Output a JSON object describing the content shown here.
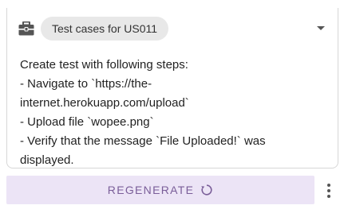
{
  "card": {
    "chip_label": "Test cases for US011",
    "icons": {
      "leading": "briefcase-icon",
      "dropdown": "chevron-down-icon"
    },
    "lines": [
      "Create test with following steps:",
      "- Navigate to `https://the-",
      "internet.herokuapp.com/upload`",
      "- Upload file `wopee.png`",
      "- Verify that the message `File Uploaded!` was",
      "displayed."
    ]
  },
  "actions": {
    "regenerate_label": "REGENERATE",
    "regenerate_icon": "refresh-icon",
    "more_icon": "more-vert-icon"
  },
  "colors": {
    "accent_bg": "#ece4f6",
    "accent_text": "#7a5e99",
    "chip_bg": "#e8e8e8"
  }
}
